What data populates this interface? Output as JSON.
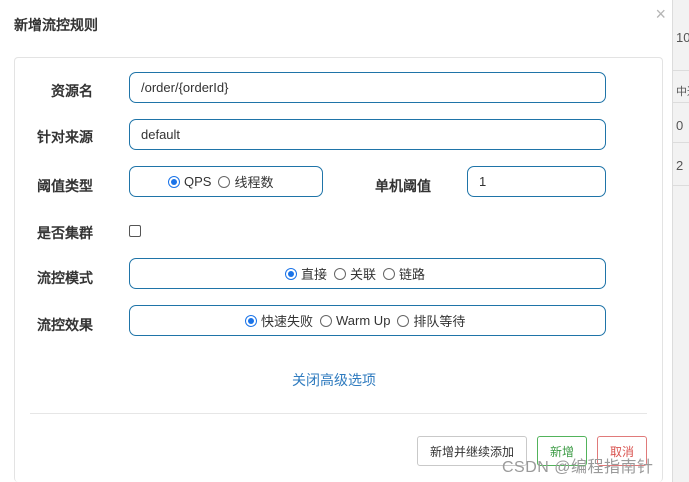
{
  "dialog": {
    "title": "新增流控规则",
    "close_symbol": "×"
  },
  "form": {
    "resource_name": {
      "label": "资源名",
      "value": "/order/{orderId}"
    },
    "source": {
      "label": "针对来源",
      "value": "default"
    },
    "threshold_type": {
      "label": "阈值类型",
      "options": [
        {
          "label": "QPS",
          "selected": true
        },
        {
          "label": "线程数",
          "selected": false
        }
      ]
    },
    "single_threshold": {
      "label": "单机阈值",
      "value": "1"
    },
    "cluster": {
      "label": "是否集群",
      "checked": false
    },
    "control_mode": {
      "label": "流控模式",
      "options": [
        {
          "label": "直接",
          "selected": true
        },
        {
          "label": "关联",
          "selected": false
        },
        {
          "label": "链路",
          "selected": false
        }
      ]
    },
    "control_effect": {
      "label": "流控效果",
      "options": [
        {
          "label": "快速失败",
          "selected": true
        },
        {
          "label": "Warm Up",
          "selected": false
        },
        {
          "label": "排队等待",
          "selected": false
        }
      ]
    },
    "advanced_link": "关闭高级选项"
  },
  "footer": {
    "add_continue": "新增并继续添加",
    "add": "新增",
    "cancel": "取消"
  },
  "background": {
    "fragments": [
      "10",
      "中通",
      "0",
      "2"
    ]
  },
  "watermark": "CSDN @编程指南针",
  "colors": {
    "accent": "#1f74a8",
    "radio_selected": "#1a73e8",
    "success": "#52b35b",
    "danger": "#d9534f",
    "link": "#2f7bbf"
  }
}
